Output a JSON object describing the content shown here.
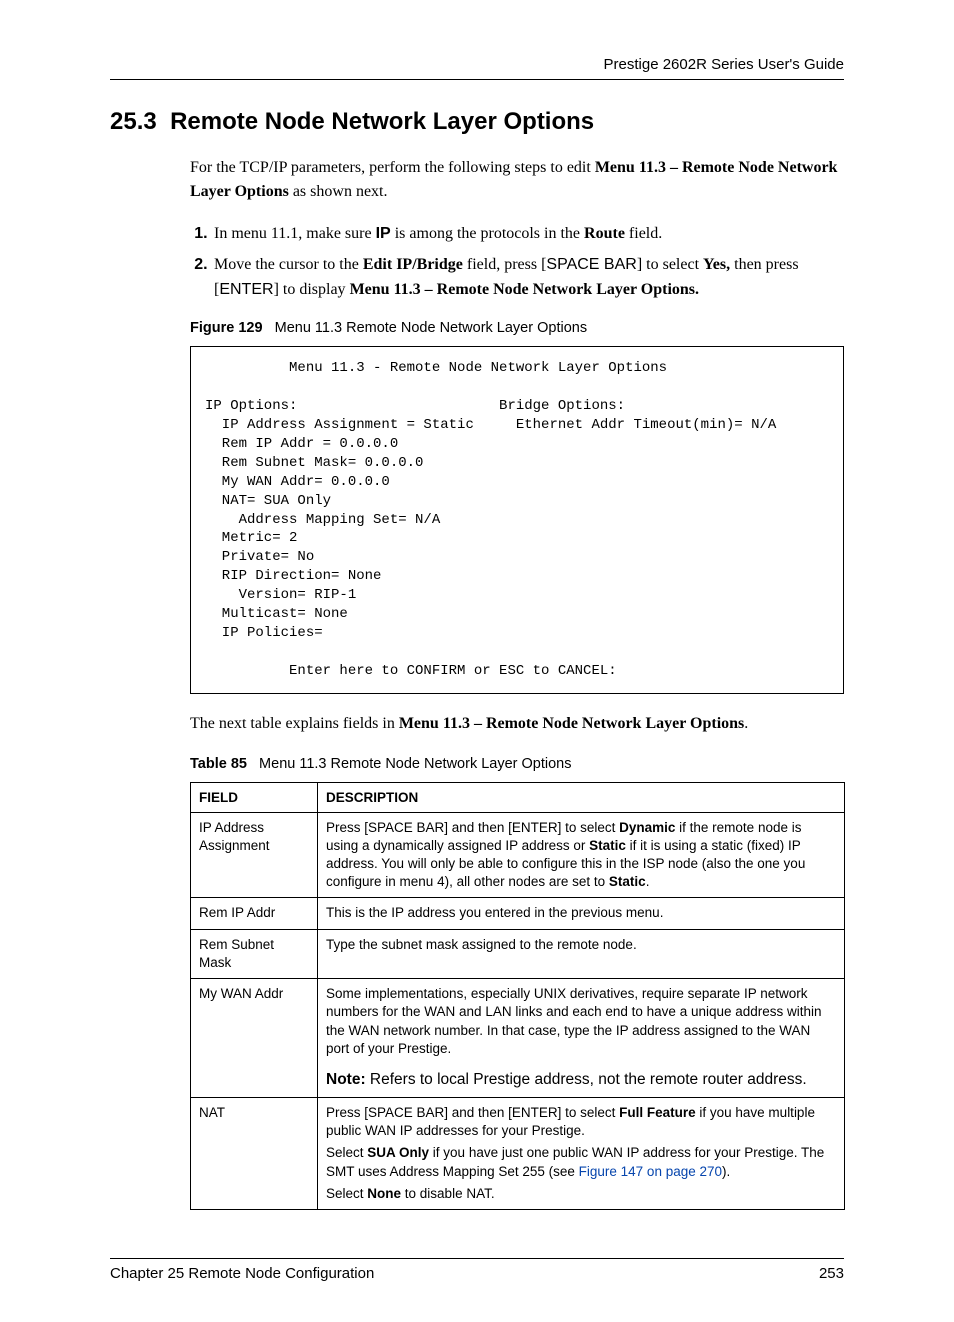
{
  "header": {
    "guide_title": "Prestige 2602R Series User's Guide"
  },
  "section": {
    "number": "25.3",
    "title": "Remote Node Network Layer Options"
  },
  "intro": {
    "pre": "For the TCP/IP parameters, perform the following steps to edit ",
    "bold": "Menu 11.3 – Remote Node Network Layer Options",
    "post": " as shown next."
  },
  "steps": {
    "s1": {
      "pre": "In menu 11.1, make sure ",
      "ip": "IP",
      "mid": " is among the protocols in the ",
      "route": "Route",
      "post": " field."
    },
    "s2": {
      "pre": "Move the cursor to the ",
      "edit": "Edit IP/Bridge",
      "mid1": " field, press [",
      "space": "SPACE BAR",
      "mid2": "] to select ",
      "yes": "Yes,",
      "mid3": " then press [",
      "enter": "ENTER",
      "mid4": "] to display ",
      "menu": "Menu 11.3 – Remote Node Network Layer Options."
    }
  },
  "figure": {
    "label": "Figure 129",
    "caption": "Menu 11.3 Remote Node Network Layer Options"
  },
  "terminal": {
    "text": "          Menu 11.3 - Remote Node Network Layer Options\n\nIP Options:                        Bridge Options:\n  IP Address Assignment = Static     Ethernet Addr Timeout(min)= N/A\n  Rem IP Addr = 0.0.0.0\n  Rem Subnet Mask= 0.0.0.0\n  My WAN Addr= 0.0.0.0\n  NAT= SUA Only\n    Address Mapping Set= N/A\n  Metric= 2\n  Private= No\n  RIP Direction= None\n    Version= RIP-1\n  Multicast= None\n  IP Policies=\n\n          Enter here to CONFIRM or ESC to CANCEL:"
  },
  "after_terminal": {
    "pre": "The next table explains fields in ",
    "bold": "Menu 11.3 – Remote Node Network Layer Options",
    "post": "."
  },
  "table": {
    "label": "Table 85",
    "caption": "Menu 11.3 Remote Node Network Layer Options",
    "head": {
      "field": "FIELD",
      "desc": "DESCRIPTION"
    },
    "rows": {
      "r1": {
        "field": "IP Address Assignment",
        "d_pre": "Press [SPACE BAR] and then [ENTER] to select ",
        "d_dyn": "Dynamic",
        "d_mid1": " if the remote node is using a dynamically assigned IP address or ",
        "d_static": "Static",
        "d_mid2": " if it is using a static (fixed) IP address. You will only be able to configure this in the ISP node (also the one you configure in menu 4), all other nodes are set to ",
        "d_static2": "Static",
        "d_post": "."
      },
      "r2": {
        "field": "Rem IP Addr",
        "desc": "This is the IP address you entered in the previous menu."
      },
      "r3": {
        "field": "Rem Subnet Mask",
        "desc": "Type the subnet mask assigned to the remote node."
      },
      "r4": {
        "field": "My WAN Addr",
        "desc": "Some implementations, especially UNIX derivatives, require separate IP network numbers for the WAN and LAN links and each end to have a unique address within the WAN network number. In that case, type the IP address assigned to the WAN port of your Prestige.",
        "note_label": "Note:",
        "note_text": " Refers to local Prestige address, not the remote router address."
      },
      "r5": {
        "field": "NAT",
        "l1_pre": "Press [SPACE BAR] and then [ENTER] to select ",
        "l1_ff": "Full Feature",
        "l1_post": " if you have multiple public WAN IP addresses for your Prestige.",
        "l2_pre": "Select ",
        "l2_sua": "SUA Only",
        "l2_mid": " if you have just one public WAN IP address for your Prestige. The SMT uses Address Mapping Set 255 (see ",
        "l2_link": "Figure 147 on page 270",
        "l2_post": ").",
        "l3_pre": "Select ",
        "l3_none": "None",
        "l3_post": " to disable NAT."
      }
    }
  },
  "footer": {
    "chapter": "Chapter 25 Remote Node Configuration",
    "page": "253"
  }
}
